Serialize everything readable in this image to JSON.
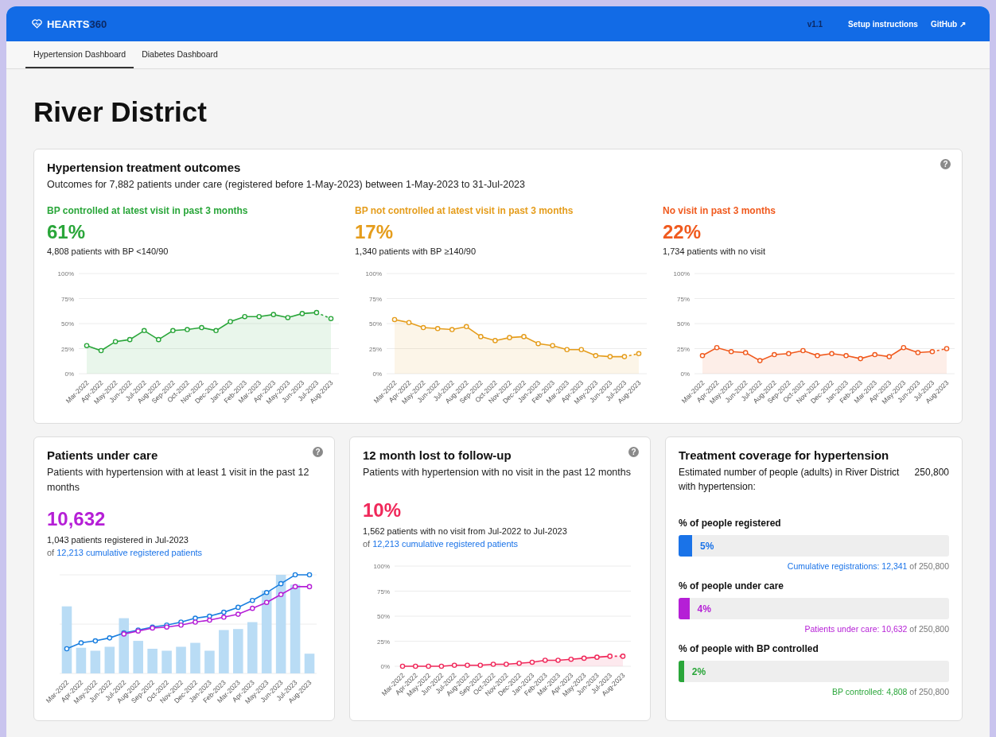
{
  "header": {
    "logo_main": "HEARTS",
    "logo_accent": "360",
    "version": "v1.1",
    "links": [
      {
        "label": "Setup instructions"
      },
      {
        "label": "GitHub ↗"
      }
    ]
  },
  "tabs": [
    {
      "label": "Hypertension Dashboard",
      "selected": true
    },
    {
      "label": "Diabetes Dashboard",
      "selected": false
    }
  ],
  "page_title": "River District",
  "outcomes": {
    "title": "Hypertension treatment outcomes",
    "subtitle": "Outcomes for 7,882 patients under care (registered before 1-May-2023) between 1-May-2023 to 31-Jul-2023",
    "help": "?",
    "columns": [
      {
        "heading": "BP controlled at latest visit in past 3 months",
        "percent": "61%",
        "detail": "4,808 patients with BP <140/90",
        "color": "#2aa63a",
        "chart_data": {
          "type": "area",
          "categories": [
            "Mar-2022",
            "Apr-2022",
            "May-2022",
            "Jun-2022",
            "Jul-2022",
            "Aug-2022",
            "Sep-2022",
            "Oct-2022",
            "Nov-2022",
            "Dec-2022",
            "Jan-2023",
            "Feb-2023",
            "Mar-2023",
            "Apr-2023",
            "May-2023",
            "Jun-2023",
            "Jul-2023",
            "Aug-2023"
          ],
          "series": [
            {
              "color": "#2aa63a",
              "values": [
                28,
                23,
                32,
                34,
                43,
                34,
                43,
                44,
                46,
                43,
                52,
                57,
                57,
                59,
                56,
                60,
                61,
                55
              ]
            }
          ],
          "grid": true,
          "ylim": [
            0,
            100
          ],
          "yticks": [
            {
              "value": 0,
              "label": "0%"
            },
            {
              "value": 25,
              "label": "25%"
            },
            {
              "value": 50,
              "label": "50%"
            },
            {
              "value": 75,
              "label": "75%"
            },
            {
              "value": 100,
              "label": "100%"
            }
          ]
        }
      },
      {
        "heading": "BP not controlled at latest visit in past 3 months",
        "percent": "17%",
        "detail": "1,340 patients with BP ≥140/90",
        "color": "#e59d1c",
        "chart_data": {
          "type": "area",
          "categories": [
            "Mar-2022",
            "Apr-2022",
            "May-2022",
            "Jun-2022",
            "Jul-2022",
            "Aug-2022",
            "Sep-2022",
            "Oct-2022",
            "Nov-2022",
            "Dec-2022",
            "Jan-2023",
            "Feb-2023",
            "Mar-2023",
            "Apr-2023",
            "May-2023",
            "Jun-2023",
            "Jul-2023",
            "Aug-2023"
          ],
          "series": [
            {
              "color": "#e59d1c",
              "values": [
                54,
                51,
                46,
                45,
                44,
                47,
                37,
                33,
                36,
                37,
                30,
                28,
                24,
                24,
                18,
                17,
                17,
                20
              ]
            }
          ],
          "grid": true,
          "ylim": [
            0,
            100
          ],
          "yticks": [
            {
              "value": 0,
              "label": "0%"
            },
            {
              "value": 25,
              "label": "25%"
            },
            {
              "value": 50,
              "label": "50%"
            },
            {
              "value": 75,
              "label": "75%"
            },
            {
              "value": 100,
              "label": "100%"
            }
          ]
        }
      },
      {
        "heading": "No visit in past 3 months",
        "percent": "22%",
        "detail": "1,734 patients with no visit",
        "color": "#f05a1e",
        "chart_data": {
          "type": "area",
          "categories": [
            "Mar-2022",
            "Apr-2022",
            "May-2022",
            "Jun-2022",
            "Jul-2022",
            "Aug-2022",
            "Sep-2022",
            "Oct-2022",
            "Nov-2022",
            "Dec-2022",
            "Jan-2023",
            "Feb-2023",
            "Mar-2023",
            "Apr-2023",
            "May-2023",
            "Jun-2023",
            "Jul-2023",
            "Aug-2023"
          ],
          "series": [
            {
              "color": "#f05a1e",
              "values": [
                18,
                26,
                22,
                21,
                13,
                19,
                20,
                23,
                18,
                20,
                18,
                15,
                19,
                17,
                26,
                21,
                22,
                25
              ]
            }
          ],
          "grid": true,
          "ylim": [
            0,
            100
          ],
          "yticks": [
            {
              "value": 0,
              "label": "0%"
            },
            {
              "value": 25,
              "label": "25%"
            },
            {
              "value": 50,
              "label": "50%"
            },
            {
              "value": 75,
              "label": "75%"
            },
            {
              "value": 100,
              "label": "100%"
            }
          ]
        }
      }
    ]
  },
  "under_care": {
    "title": "Patients under care",
    "help": "?",
    "subtitle": "Patients with hypertension with at least 1 visit in the past 12 months",
    "value": "10,632",
    "detail": "1,043 patients registered in Jul-2023",
    "of_text": "of",
    "link": "12,213 cumulative registered patients",
    "chart": {
      "kind": "picture",
      "x_labels": [
        "Mar-2022",
        "Apr-2022",
        "May-2022",
        "Jun-2022",
        "Jul-2022",
        "Aug-2022",
        "Sep-2022",
        "Oct-2022",
        "Nov-2022",
        "Dec-2022",
        "Jan-2023",
        "Feb-2023",
        "Mar-2023",
        "Apr-2023",
        "May-2023",
        "Jun-2023",
        "Jul-2023",
        "Aug-2023"
      ]
    }
  },
  "lost_to_follow_up": {
    "title": "12 month lost to follow-up",
    "help": "?",
    "subtitle": "Patients with hypertension with no visit in the past 12 months",
    "value": "10%",
    "detail": "1,562 patients with no visit from Jul-2022 to Jul-2023",
    "of_text": "of",
    "link": "12,213 cumulative registered patients",
    "chart_data": {
      "type": "area",
      "categories": [
        "Mar-2022",
        "Apr-2022",
        "May-2022",
        "Jun-2022",
        "Jul-2022",
        "Aug-2022",
        "Sep-2022",
        "Oct-2022",
        "Nov-2022",
        "Dec-2022",
        "Jan-2023",
        "Feb-2023",
        "Mar-2023",
        "Apr-2023",
        "May-2023",
        "Jun-2023",
        "Jul-2023",
        "Aug-2023"
      ],
      "series": [
        {
          "color": "#f0285a",
          "values": [
            0,
            0,
            0,
            0,
            1,
            1,
            1,
            2,
            2,
            3,
            4,
            6,
            6,
            7,
            8,
            9,
            10,
            10
          ]
        }
      ],
      "grid": true,
      "ylim": [
        0,
        100
      ],
      "yticks": [
        {
          "value": 0,
          "label": "0%"
        },
        {
          "value": 25,
          "label": "25%"
        },
        {
          "value": 50,
          "label": "50%"
        },
        {
          "value": 75,
          "label": "75%"
        },
        {
          "value": 100,
          "label": "100%"
        }
      ]
    }
  },
  "coverage": {
    "title": "Treatment coverage for hypertension",
    "description": "Estimated number of people (adults) in River District with hypertension:",
    "estimate": "250,800",
    "metrics": [
      {
        "label": "% of people registered",
        "percent": "5%",
        "level": 0.05,
        "color": "#1a73e8",
        "note_highlight": "Cumulative registrations: 12,341",
        "note_rest": "of 250,800"
      },
      {
        "label": "% of people under care",
        "percent": "4%",
        "level": 0.04,
        "color": "#b51fd6",
        "note_highlight": "Patients under care: 10,632",
        "note_rest": "of 250,800"
      },
      {
        "label": "% of people with BP controlled",
        "percent": "2%",
        "level": 0.02,
        "color": "#2aa63a",
        "note_highlight": "BP controlled: 4,808",
        "note_rest": "of 250,800"
      }
    ]
  }
}
